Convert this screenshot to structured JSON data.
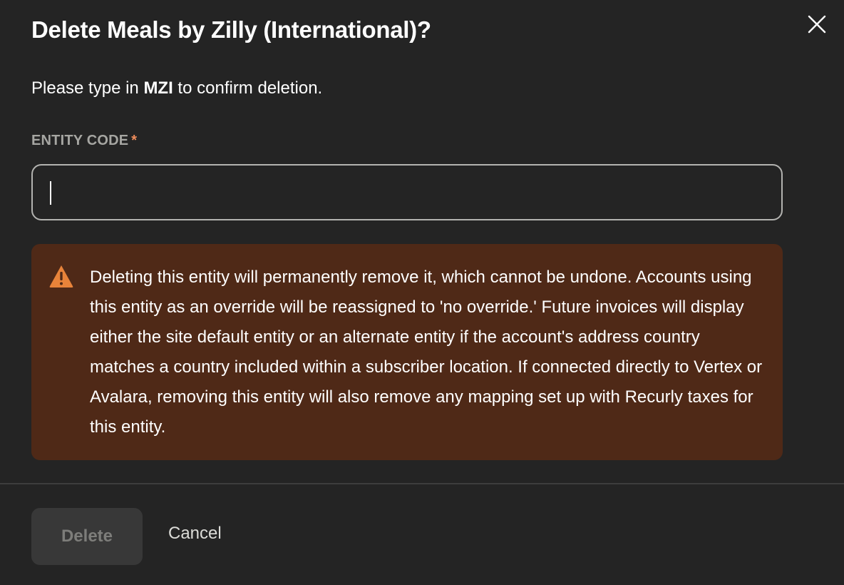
{
  "dialog": {
    "title": "Delete Meals by Zilly (International)?",
    "close_icon": "close-icon"
  },
  "instruction": {
    "prefix": "Please type in ",
    "code": "MZI",
    "suffix": " to confirm deletion."
  },
  "field": {
    "label": "ENTITY CODE",
    "required_marker": "*",
    "value": "",
    "placeholder": ""
  },
  "warning": {
    "icon": "warning-triangle-icon",
    "text": "Deleting this entity will permanently remove it, which cannot be undone. Accounts using this entity as an override will be reassigned to 'no override.' Future invoices will display either the site default entity or an alternate entity if the account's address country matches a country included within a subscriber location. If connected directly to Vertex or Avalara, removing this entity will also remove any mapping set up with Recurly taxes for this entity."
  },
  "actions": {
    "delete_label": "Delete",
    "delete_state": "disabled",
    "cancel_label": "Cancel"
  },
  "colors": {
    "background": "#242424",
    "warning_bg": "#4f2917",
    "warning_icon": "#e8833a",
    "required": "#f08d5c",
    "label": "#a6a6a2"
  }
}
